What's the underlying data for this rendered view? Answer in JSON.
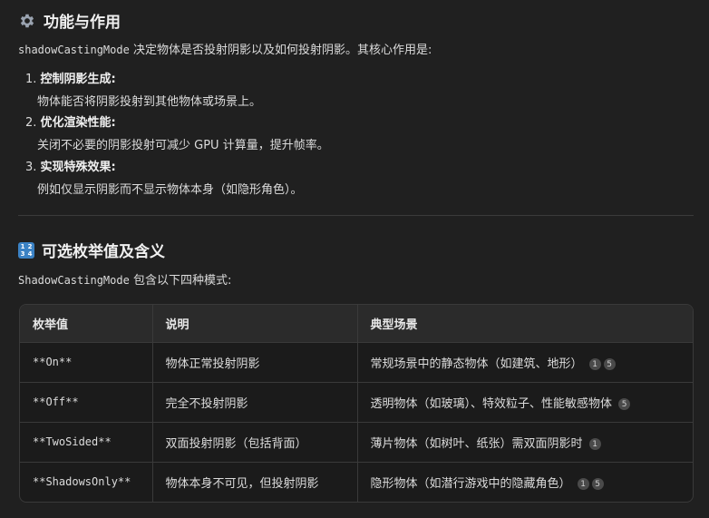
{
  "section1": {
    "title": "功能与作用",
    "intro_code": "shadowCastingMode",
    "intro_text": " 决定物体是否投射阴影以及如何投射阴影。其核心作用是:",
    "items": [
      {
        "num": "1.",
        "title": "控制阴影生成:",
        "desc": "物体能否将阴影投射到其他物体或场景上。"
      },
      {
        "num": "2.",
        "title": "优化渲染性能:",
        "desc": "关闭不必要的阴影投射可减少 GPU 计算量，提升帧率。"
      },
      {
        "num": "3.",
        "title": "实现特殊效果:",
        "desc": "例如仅显示阴影而不显示物体本身（如隐形角色）。"
      }
    ]
  },
  "section2": {
    "title": "可选枚举值及含义",
    "badge": [
      "1",
      "2",
      "3",
      "4"
    ],
    "intro_code": "ShadowCastingMode",
    "intro_text": " 包含以下四种模式:"
  },
  "table": {
    "headers": [
      "枚举值",
      "说明",
      "典型场景"
    ],
    "rows": [
      {
        "value": "**On**",
        "desc": "物体正常投射阴影",
        "scene": "常规场景中的静态物体（如建筑、地形）",
        "cites": [
          "1",
          "5"
        ]
      },
      {
        "value": "**Off**",
        "desc": "完全不投射阴影",
        "scene": "透明物体（如玻璃）、特效粒子、性能敏感物体",
        "cites": [
          "5"
        ]
      },
      {
        "value": "**TwoSided**",
        "desc": "双面投射阴影（包括背面）",
        "scene": "薄片物体（如树叶、纸张）需双面阴影时",
        "cites": [
          "1"
        ]
      },
      {
        "value": "**ShadowsOnly**",
        "desc": "物体本身不可见，但投射阴影",
        "scene": "隐形物体（如潜行游戏中的隐藏角色）",
        "cites": [
          "1",
          "5"
        ]
      }
    ]
  }
}
